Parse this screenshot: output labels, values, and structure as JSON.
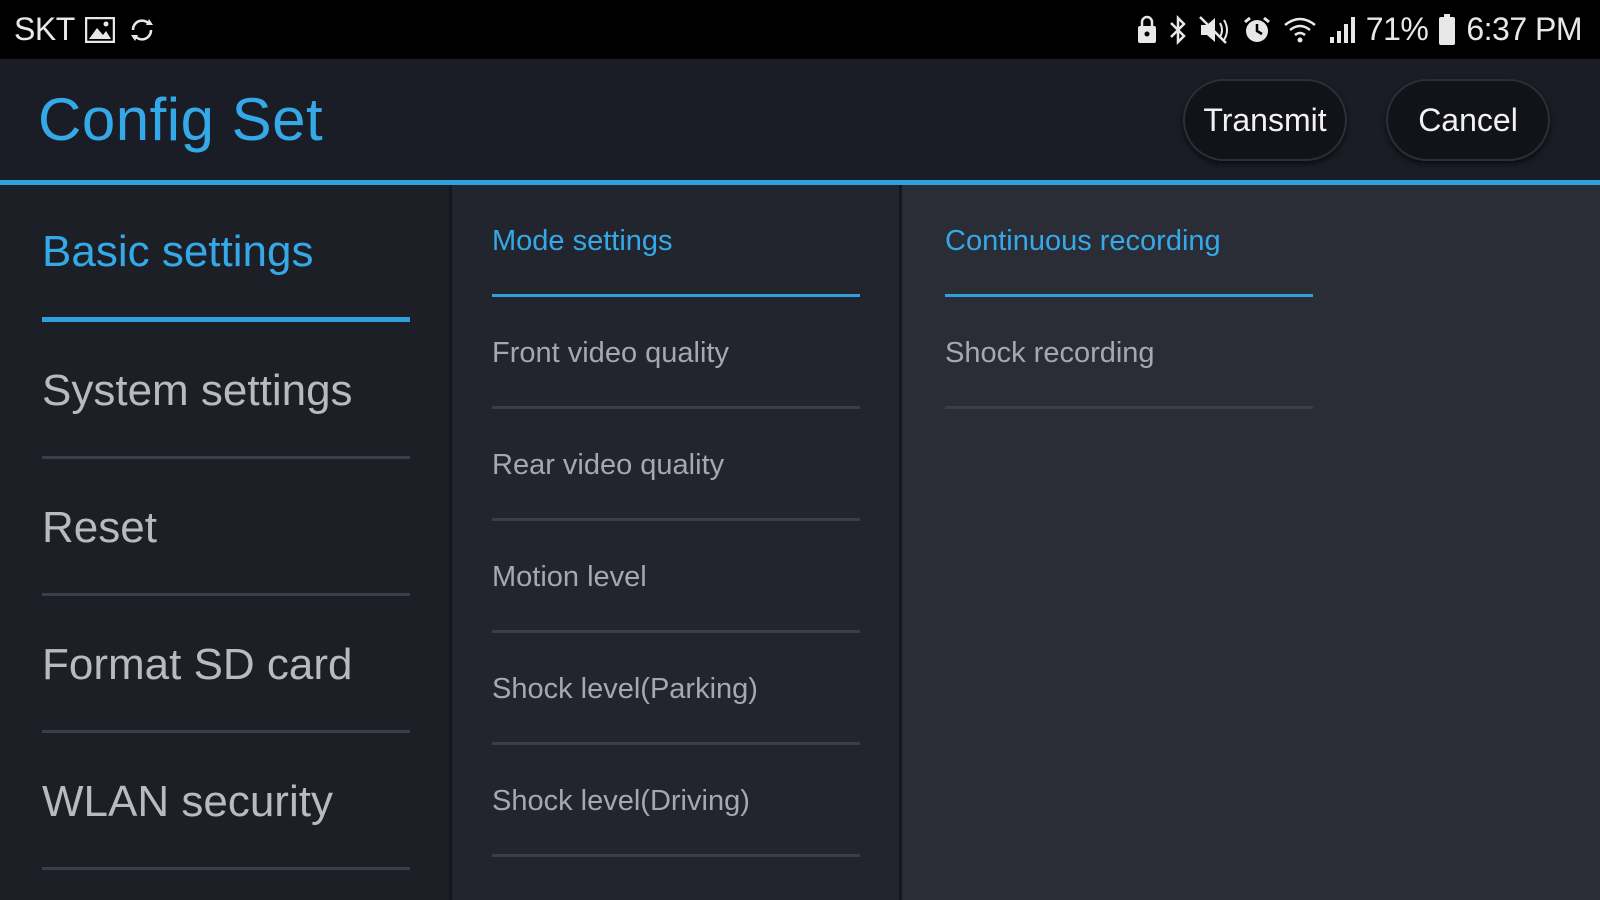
{
  "status_bar": {
    "carrier": "SKT",
    "battery_percent": "71%",
    "time": "6:37 PM",
    "left_icons": [
      "image-icon",
      "sync-icon"
    ],
    "right_icons": [
      "lock-icon",
      "bluetooth-icon",
      "mute-icon",
      "alarm-icon",
      "wifi-icon",
      "signal-icon",
      "battery-icon"
    ]
  },
  "header": {
    "title": "Config Set",
    "transmit_label": "Transmit",
    "cancel_label": "Cancel",
    "accent_color": "#35a9e8"
  },
  "categories": [
    {
      "label": "Basic settings",
      "active": true
    },
    {
      "label": "System settings",
      "active": false
    },
    {
      "label": "Reset",
      "active": false
    },
    {
      "label": "Format SD card",
      "active": false
    },
    {
      "label": "WLAN security",
      "active": false
    }
  ],
  "subcategories": [
    {
      "label": "Mode settings",
      "active": true
    },
    {
      "label": "Front video quality",
      "active": false
    },
    {
      "label": "Rear video quality",
      "active": false
    },
    {
      "label": "Motion level",
      "active": false
    },
    {
      "label": "Shock level(Parking)",
      "active": false
    },
    {
      "label": "Shock level(Driving)",
      "active": false
    }
  ],
  "options": [
    {
      "label": "Continuous recording",
      "active": true
    },
    {
      "label": "Shock recording",
      "active": false
    }
  ]
}
